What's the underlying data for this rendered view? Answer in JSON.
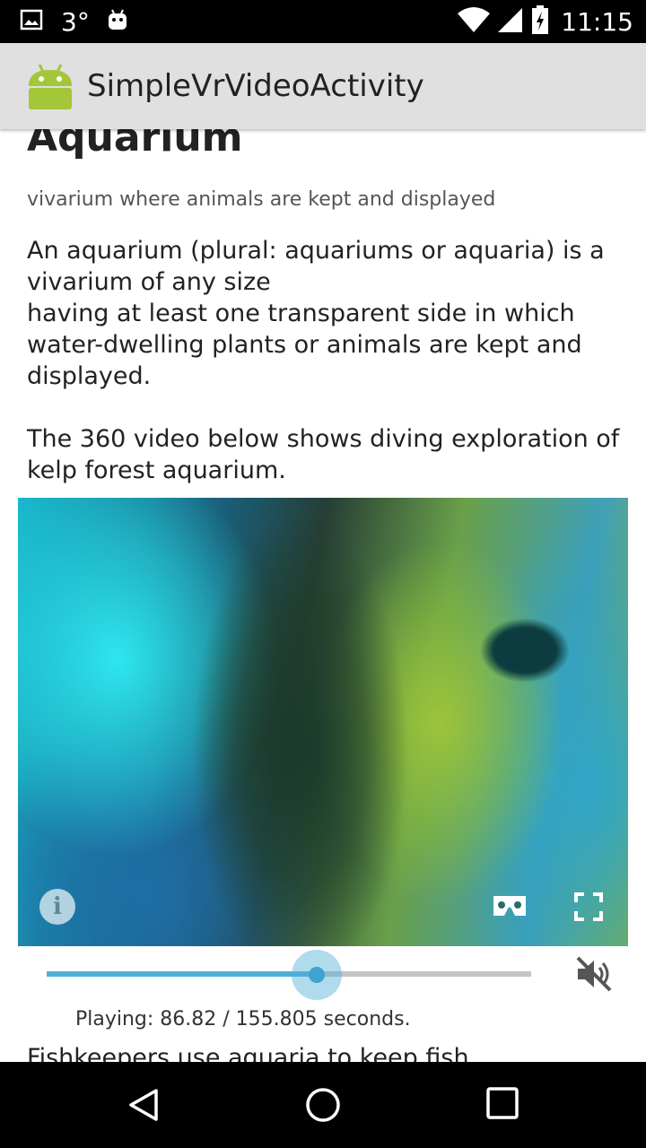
{
  "status_bar": {
    "temperature": "3°",
    "time": "11:15",
    "icons": [
      "image-notification-icon",
      "android-debug-icon",
      "wifi-icon",
      "cell-signal-icon",
      "battery-charging-icon"
    ]
  },
  "app_bar": {
    "title": "SimpleVrVideoActivity"
  },
  "article": {
    "heading": "Aquarium",
    "subtitle": "vivarium where animals are kept and displayed",
    "paragraph1_lines": [
      "An aquarium (plural: aquariums or aquaria) is a",
      "vivarium of any size",
      "having at least one transparent side in which",
      "water-dwelling plants or animals are kept and",
      "displayed."
    ],
    "paragraph2_lines": [
      "The 360 video below shows diving exploration of",
      "kelp forest aquarium."
    ],
    "paragraph3": "Fishkeepers use aquaria to keep fish"
  },
  "video": {
    "info_label": "i",
    "icons": [
      "info-icon",
      "cardboard-icon",
      "fullscreen-icon"
    ]
  },
  "playback": {
    "position_seconds": 86.82,
    "duration_seconds": 155.805,
    "progress_fraction": 0.557,
    "status_text": "Playing: 86.82 / 155.805 seconds.",
    "volume_muted": true
  },
  "colors": {
    "accent": "#4fb0d8",
    "app_bar_bg": "#e0e0e0",
    "android_green": "#a4c639"
  }
}
